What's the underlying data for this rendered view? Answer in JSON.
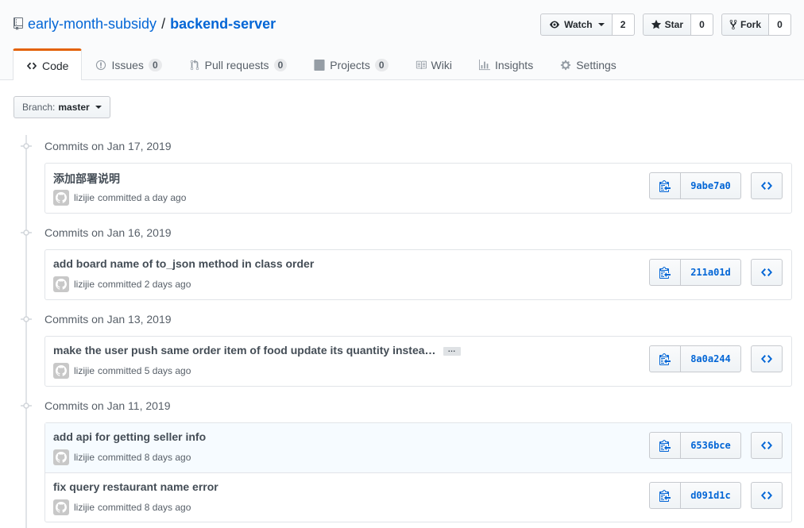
{
  "repo": {
    "owner": "early-month-subsidy",
    "separator": "/",
    "name": "backend-server"
  },
  "actions": {
    "watch": {
      "label": "Watch",
      "count": "2"
    },
    "star": {
      "label": "Star",
      "count": "0"
    },
    "fork": {
      "label": "Fork",
      "count": "0"
    }
  },
  "tabs": [
    {
      "label": "Code",
      "icon": "code-icon"
    },
    {
      "label": "Issues",
      "count": "0",
      "icon": "issue-opened-icon"
    },
    {
      "label": "Pull requests",
      "count": "0",
      "icon": "git-pull-request-icon"
    },
    {
      "label": "Projects",
      "count": "0",
      "icon": "project-icon"
    },
    {
      "label": "Wiki",
      "icon": "book-icon"
    },
    {
      "label": "Insights",
      "icon": "graph-icon"
    },
    {
      "label": "Settings",
      "icon": "gear-icon"
    }
  ],
  "branch": {
    "label": "Branch:",
    "value": "master"
  },
  "groups": [
    {
      "title": "Commits on Jan 17, 2019",
      "commits": [
        {
          "message": "添加部署说明",
          "author": "lizijie",
          "when": "committed a day ago",
          "sha": "9abe7a0"
        }
      ]
    },
    {
      "title": "Commits on Jan 16, 2019",
      "commits": [
        {
          "message": "add board name of to_json method in class order",
          "author": "lizijie",
          "when": "committed 2 days ago",
          "sha": "211a01d"
        }
      ]
    },
    {
      "title": "Commits on Jan 13, 2019",
      "commits": [
        {
          "message": "make the user push same order item of food update its quantity instea…",
          "author": "lizijie",
          "when": "committed 5 days ago",
          "sha": "8a0a244",
          "more": "…"
        }
      ]
    },
    {
      "title": "Commits on Jan 11, 2019",
      "commits": [
        {
          "message": "add api for getting seller info",
          "author": "lizijie",
          "when": "committed 8 days ago",
          "sha": "6536bce"
        },
        {
          "message": "fix query restaurant name error",
          "author": "lizijie",
          "when": "committed 8 days ago",
          "sha": "d091d1c"
        }
      ]
    }
  ],
  "colors": {
    "link": "#0366d6",
    "tab_accent": "#e36209"
  }
}
